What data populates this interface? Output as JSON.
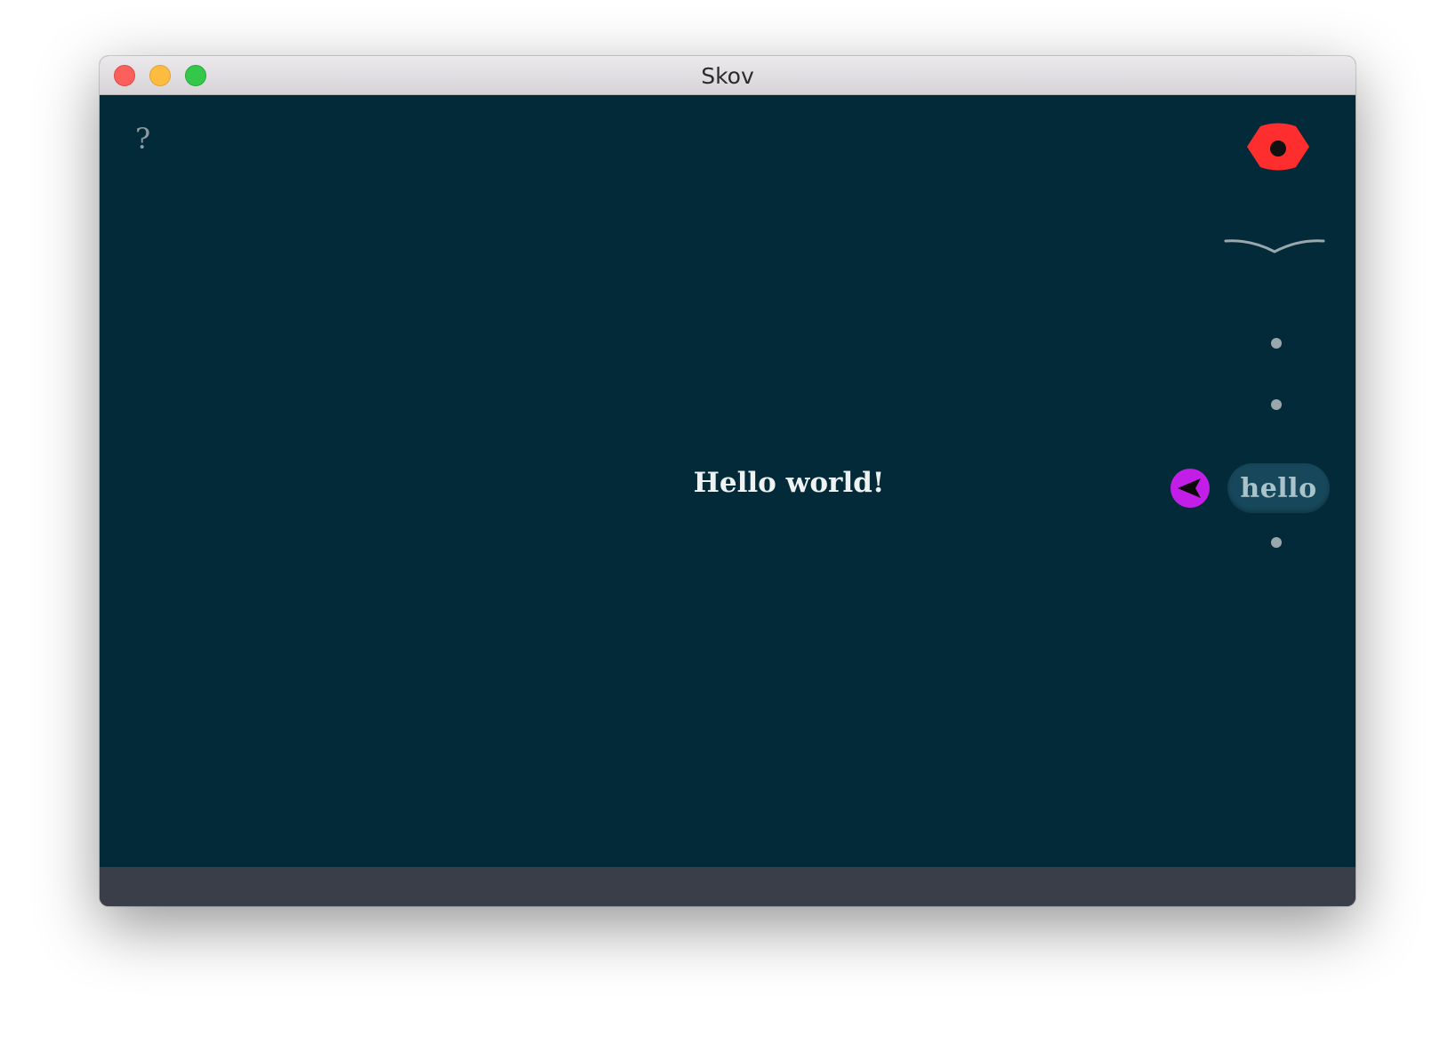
{
  "window": {
    "title": "Skov"
  },
  "canvas": {
    "help_label": "?",
    "main_text": "Hello world!",
    "input_word": "hello"
  },
  "icons": {
    "eye": "eye-icon",
    "arc": "arc-icon",
    "send": "send-arrow-icon"
  },
  "colors": {
    "background": "#022a38",
    "statusbar": "#393e48",
    "eye": "#ff2e2e",
    "send": "#c21ee8",
    "pill": "#16475a",
    "dot": "#9aa8ad"
  }
}
